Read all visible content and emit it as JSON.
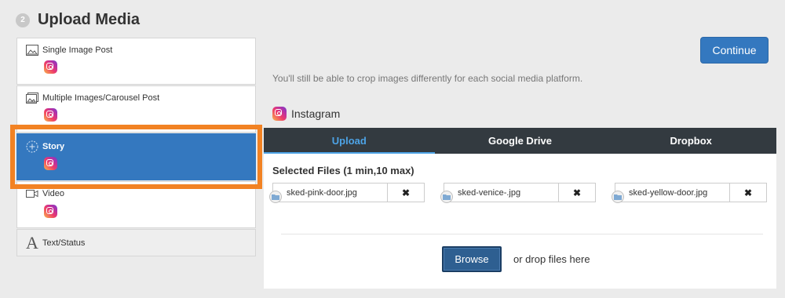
{
  "step": {
    "number": "2",
    "title": "Upload Media"
  },
  "post_types": [
    {
      "label": "Single Image Post",
      "icon": "image-icon"
    },
    {
      "label": "Multiple Images/Carousel Post",
      "icon": "images-icon"
    },
    {
      "label": "Story",
      "icon": "story-plus-icon",
      "selected": true
    },
    {
      "label": "Video",
      "icon": "video-icon"
    },
    {
      "label": "Text/Status",
      "icon": "text-a-icon"
    }
  ],
  "continue_label": "Continue",
  "hint": "You'll still be able to crop images differently for each social media platform.",
  "platform": {
    "label": "Instagram",
    "icon": "instagram-icon"
  },
  "tabs": [
    {
      "label": "Upload",
      "active": true
    },
    {
      "label": "Google Drive"
    },
    {
      "label": "Dropbox"
    }
  ],
  "selected_files_title": "Selected Files (1 min,10 max)",
  "files": [
    {
      "name": "sked-pink-door.jpg",
      "remove": "✖"
    },
    {
      "name": "sked-venice-.jpg",
      "remove": "✖"
    },
    {
      "name": "sked-yellow-door.jpg",
      "remove": "✖"
    }
  ],
  "browse_label": "Browse",
  "drop_text": "or drop files here",
  "colors": {
    "accent": "#3478bf",
    "highlight": "#f28223",
    "tab_bar": "#333a40",
    "tab_active": "#4da3e6"
  }
}
